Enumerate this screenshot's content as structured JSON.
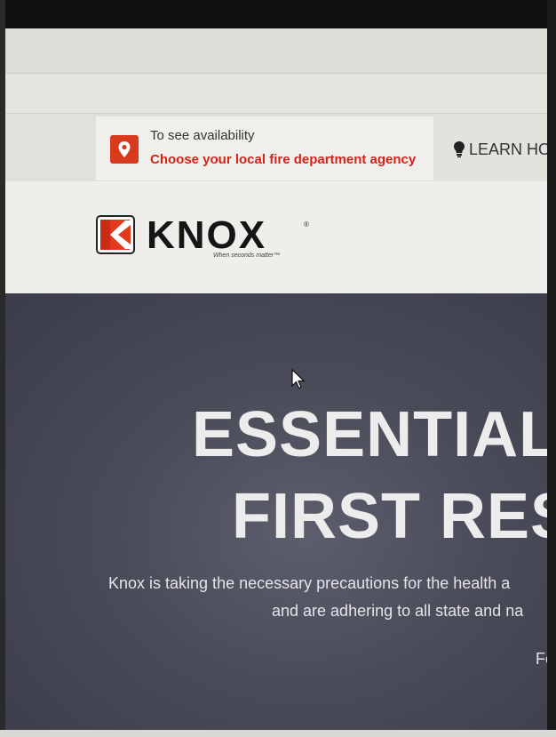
{
  "location_bar": {
    "prompt": "To see availability",
    "agency_link": "Choose your local fire department agency",
    "learn_how": "LEARN HOW"
  },
  "brand": {
    "name": "KNOX",
    "registered": "®",
    "tagline": "When seconds matter™",
    "accent_color": "#d4231a"
  },
  "hero": {
    "headline_line1": "ESSENTIAL",
    "headline_line2": "FIRST RESI",
    "body_line1": "Knox is taking the necessary precautions for the health a",
    "body_line2": "and are adhering to all state and na",
    "body_line3": "Fo"
  }
}
